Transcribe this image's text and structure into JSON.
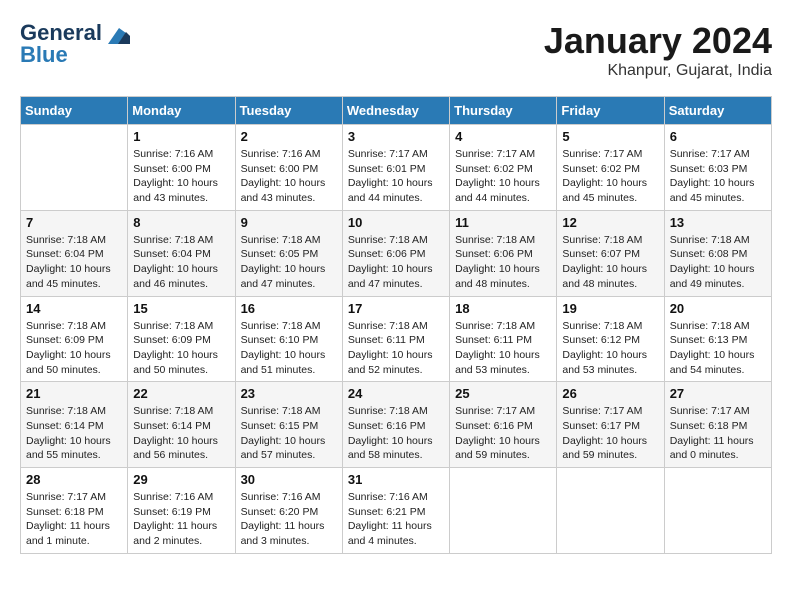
{
  "header": {
    "logo_line1": "General",
    "logo_line2": "Blue",
    "month_year": "January 2024",
    "location": "Khanpur, Gujarat, India"
  },
  "weekdays": [
    "Sunday",
    "Monday",
    "Tuesday",
    "Wednesday",
    "Thursday",
    "Friday",
    "Saturday"
  ],
  "weeks": [
    [
      {
        "day": "",
        "info": ""
      },
      {
        "day": "1",
        "info": "Sunrise: 7:16 AM\nSunset: 6:00 PM\nDaylight: 10 hours\nand 43 minutes."
      },
      {
        "day": "2",
        "info": "Sunrise: 7:16 AM\nSunset: 6:00 PM\nDaylight: 10 hours\nand 43 minutes."
      },
      {
        "day": "3",
        "info": "Sunrise: 7:17 AM\nSunset: 6:01 PM\nDaylight: 10 hours\nand 44 minutes."
      },
      {
        "day": "4",
        "info": "Sunrise: 7:17 AM\nSunset: 6:02 PM\nDaylight: 10 hours\nand 44 minutes."
      },
      {
        "day": "5",
        "info": "Sunrise: 7:17 AM\nSunset: 6:02 PM\nDaylight: 10 hours\nand 45 minutes."
      },
      {
        "day": "6",
        "info": "Sunrise: 7:17 AM\nSunset: 6:03 PM\nDaylight: 10 hours\nand 45 minutes."
      }
    ],
    [
      {
        "day": "7",
        "info": "Sunrise: 7:18 AM\nSunset: 6:04 PM\nDaylight: 10 hours\nand 45 minutes."
      },
      {
        "day": "8",
        "info": "Sunrise: 7:18 AM\nSunset: 6:04 PM\nDaylight: 10 hours\nand 46 minutes."
      },
      {
        "day": "9",
        "info": "Sunrise: 7:18 AM\nSunset: 6:05 PM\nDaylight: 10 hours\nand 47 minutes."
      },
      {
        "day": "10",
        "info": "Sunrise: 7:18 AM\nSunset: 6:06 PM\nDaylight: 10 hours\nand 47 minutes."
      },
      {
        "day": "11",
        "info": "Sunrise: 7:18 AM\nSunset: 6:06 PM\nDaylight: 10 hours\nand 48 minutes."
      },
      {
        "day": "12",
        "info": "Sunrise: 7:18 AM\nSunset: 6:07 PM\nDaylight: 10 hours\nand 48 minutes."
      },
      {
        "day": "13",
        "info": "Sunrise: 7:18 AM\nSunset: 6:08 PM\nDaylight: 10 hours\nand 49 minutes."
      }
    ],
    [
      {
        "day": "14",
        "info": "Sunrise: 7:18 AM\nSunset: 6:09 PM\nDaylight: 10 hours\nand 50 minutes."
      },
      {
        "day": "15",
        "info": "Sunrise: 7:18 AM\nSunset: 6:09 PM\nDaylight: 10 hours\nand 50 minutes."
      },
      {
        "day": "16",
        "info": "Sunrise: 7:18 AM\nSunset: 6:10 PM\nDaylight: 10 hours\nand 51 minutes."
      },
      {
        "day": "17",
        "info": "Sunrise: 7:18 AM\nSunset: 6:11 PM\nDaylight: 10 hours\nand 52 minutes."
      },
      {
        "day": "18",
        "info": "Sunrise: 7:18 AM\nSunset: 6:11 PM\nDaylight: 10 hours\nand 53 minutes."
      },
      {
        "day": "19",
        "info": "Sunrise: 7:18 AM\nSunset: 6:12 PM\nDaylight: 10 hours\nand 53 minutes."
      },
      {
        "day": "20",
        "info": "Sunrise: 7:18 AM\nSunset: 6:13 PM\nDaylight: 10 hours\nand 54 minutes."
      }
    ],
    [
      {
        "day": "21",
        "info": "Sunrise: 7:18 AM\nSunset: 6:14 PM\nDaylight: 10 hours\nand 55 minutes."
      },
      {
        "day": "22",
        "info": "Sunrise: 7:18 AM\nSunset: 6:14 PM\nDaylight: 10 hours\nand 56 minutes."
      },
      {
        "day": "23",
        "info": "Sunrise: 7:18 AM\nSunset: 6:15 PM\nDaylight: 10 hours\nand 57 minutes."
      },
      {
        "day": "24",
        "info": "Sunrise: 7:18 AM\nSunset: 6:16 PM\nDaylight: 10 hours\nand 58 minutes."
      },
      {
        "day": "25",
        "info": "Sunrise: 7:17 AM\nSunset: 6:16 PM\nDaylight: 10 hours\nand 59 minutes."
      },
      {
        "day": "26",
        "info": "Sunrise: 7:17 AM\nSunset: 6:17 PM\nDaylight: 10 hours\nand 59 minutes."
      },
      {
        "day": "27",
        "info": "Sunrise: 7:17 AM\nSunset: 6:18 PM\nDaylight: 11 hours\nand 0 minutes."
      }
    ],
    [
      {
        "day": "28",
        "info": "Sunrise: 7:17 AM\nSunset: 6:18 PM\nDaylight: 11 hours\nand 1 minute."
      },
      {
        "day": "29",
        "info": "Sunrise: 7:16 AM\nSunset: 6:19 PM\nDaylight: 11 hours\nand 2 minutes."
      },
      {
        "day": "30",
        "info": "Sunrise: 7:16 AM\nSunset: 6:20 PM\nDaylight: 11 hours\nand 3 minutes."
      },
      {
        "day": "31",
        "info": "Sunrise: 7:16 AM\nSunset: 6:21 PM\nDaylight: 11 hours\nand 4 minutes."
      },
      {
        "day": "",
        "info": ""
      },
      {
        "day": "",
        "info": ""
      },
      {
        "day": "",
        "info": ""
      }
    ]
  ]
}
